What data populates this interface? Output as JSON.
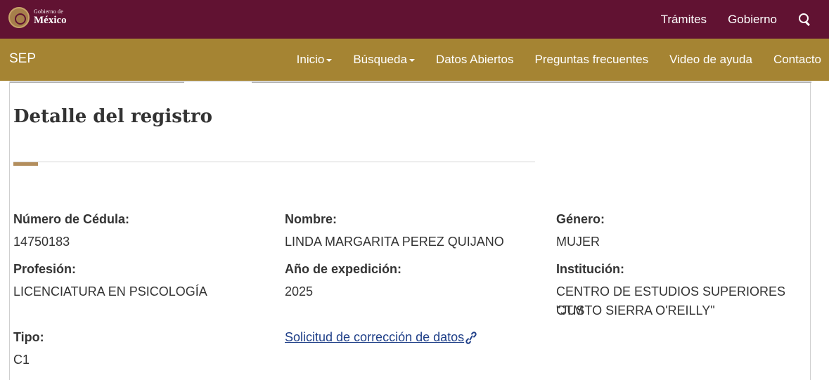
{
  "gov_bar": {
    "logo_small": "Gobierno de",
    "logo_big": "México",
    "links": [
      "Trámites",
      "Gobierno"
    ],
    "search_icon": "search-icon"
  },
  "sep_bar": {
    "brand": "SEP",
    "nav": [
      {
        "label": "Inicio",
        "has_caret": true
      },
      {
        "label": "Búsqueda",
        "has_caret": true
      },
      {
        "label": "Datos Abiertos",
        "has_caret": false
      },
      {
        "label": "Preguntas frecuentes",
        "has_caret": false
      },
      {
        "label": "Video de ayuda",
        "has_caret": false
      },
      {
        "label": "Contacto",
        "has_caret": false
      }
    ]
  },
  "main": {
    "title": "Detalle del registro",
    "fields": {
      "cedula": {
        "label": "Número de Cédula:",
        "value": "14750183"
      },
      "nombre": {
        "label": "Nombre:",
        "value": "LINDA MARGARITA PEREZ QUIJANO"
      },
      "genero": {
        "label": "Género:",
        "value": "MUJER"
      },
      "profesion": {
        "label": "Profesión:",
        "value": "LICENCIATURA EN PSICOLOGÍA"
      },
      "anio": {
        "label": "Año de expedición:",
        "value": "2025"
      },
      "institucion": {
        "label": "Institución:",
        "value_line1": "CENTRO DE ESTUDIOS SUPERIORES CTM",
        "value_line2": "\"JUSTO SIERRA O'REILLY\""
      },
      "tipo": {
        "label": "Tipo:",
        "value": "C1"
      }
    },
    "correction_link": "Solicitud de corrección de datos",
    "link_icon": "link-icon"
  },
  "colors": {
    "gov_bar": "#611232",
    "sep_bar": "#a58433",
    "accent": "#b38e5d",
    "link": "#1f3f88"
  }
}
